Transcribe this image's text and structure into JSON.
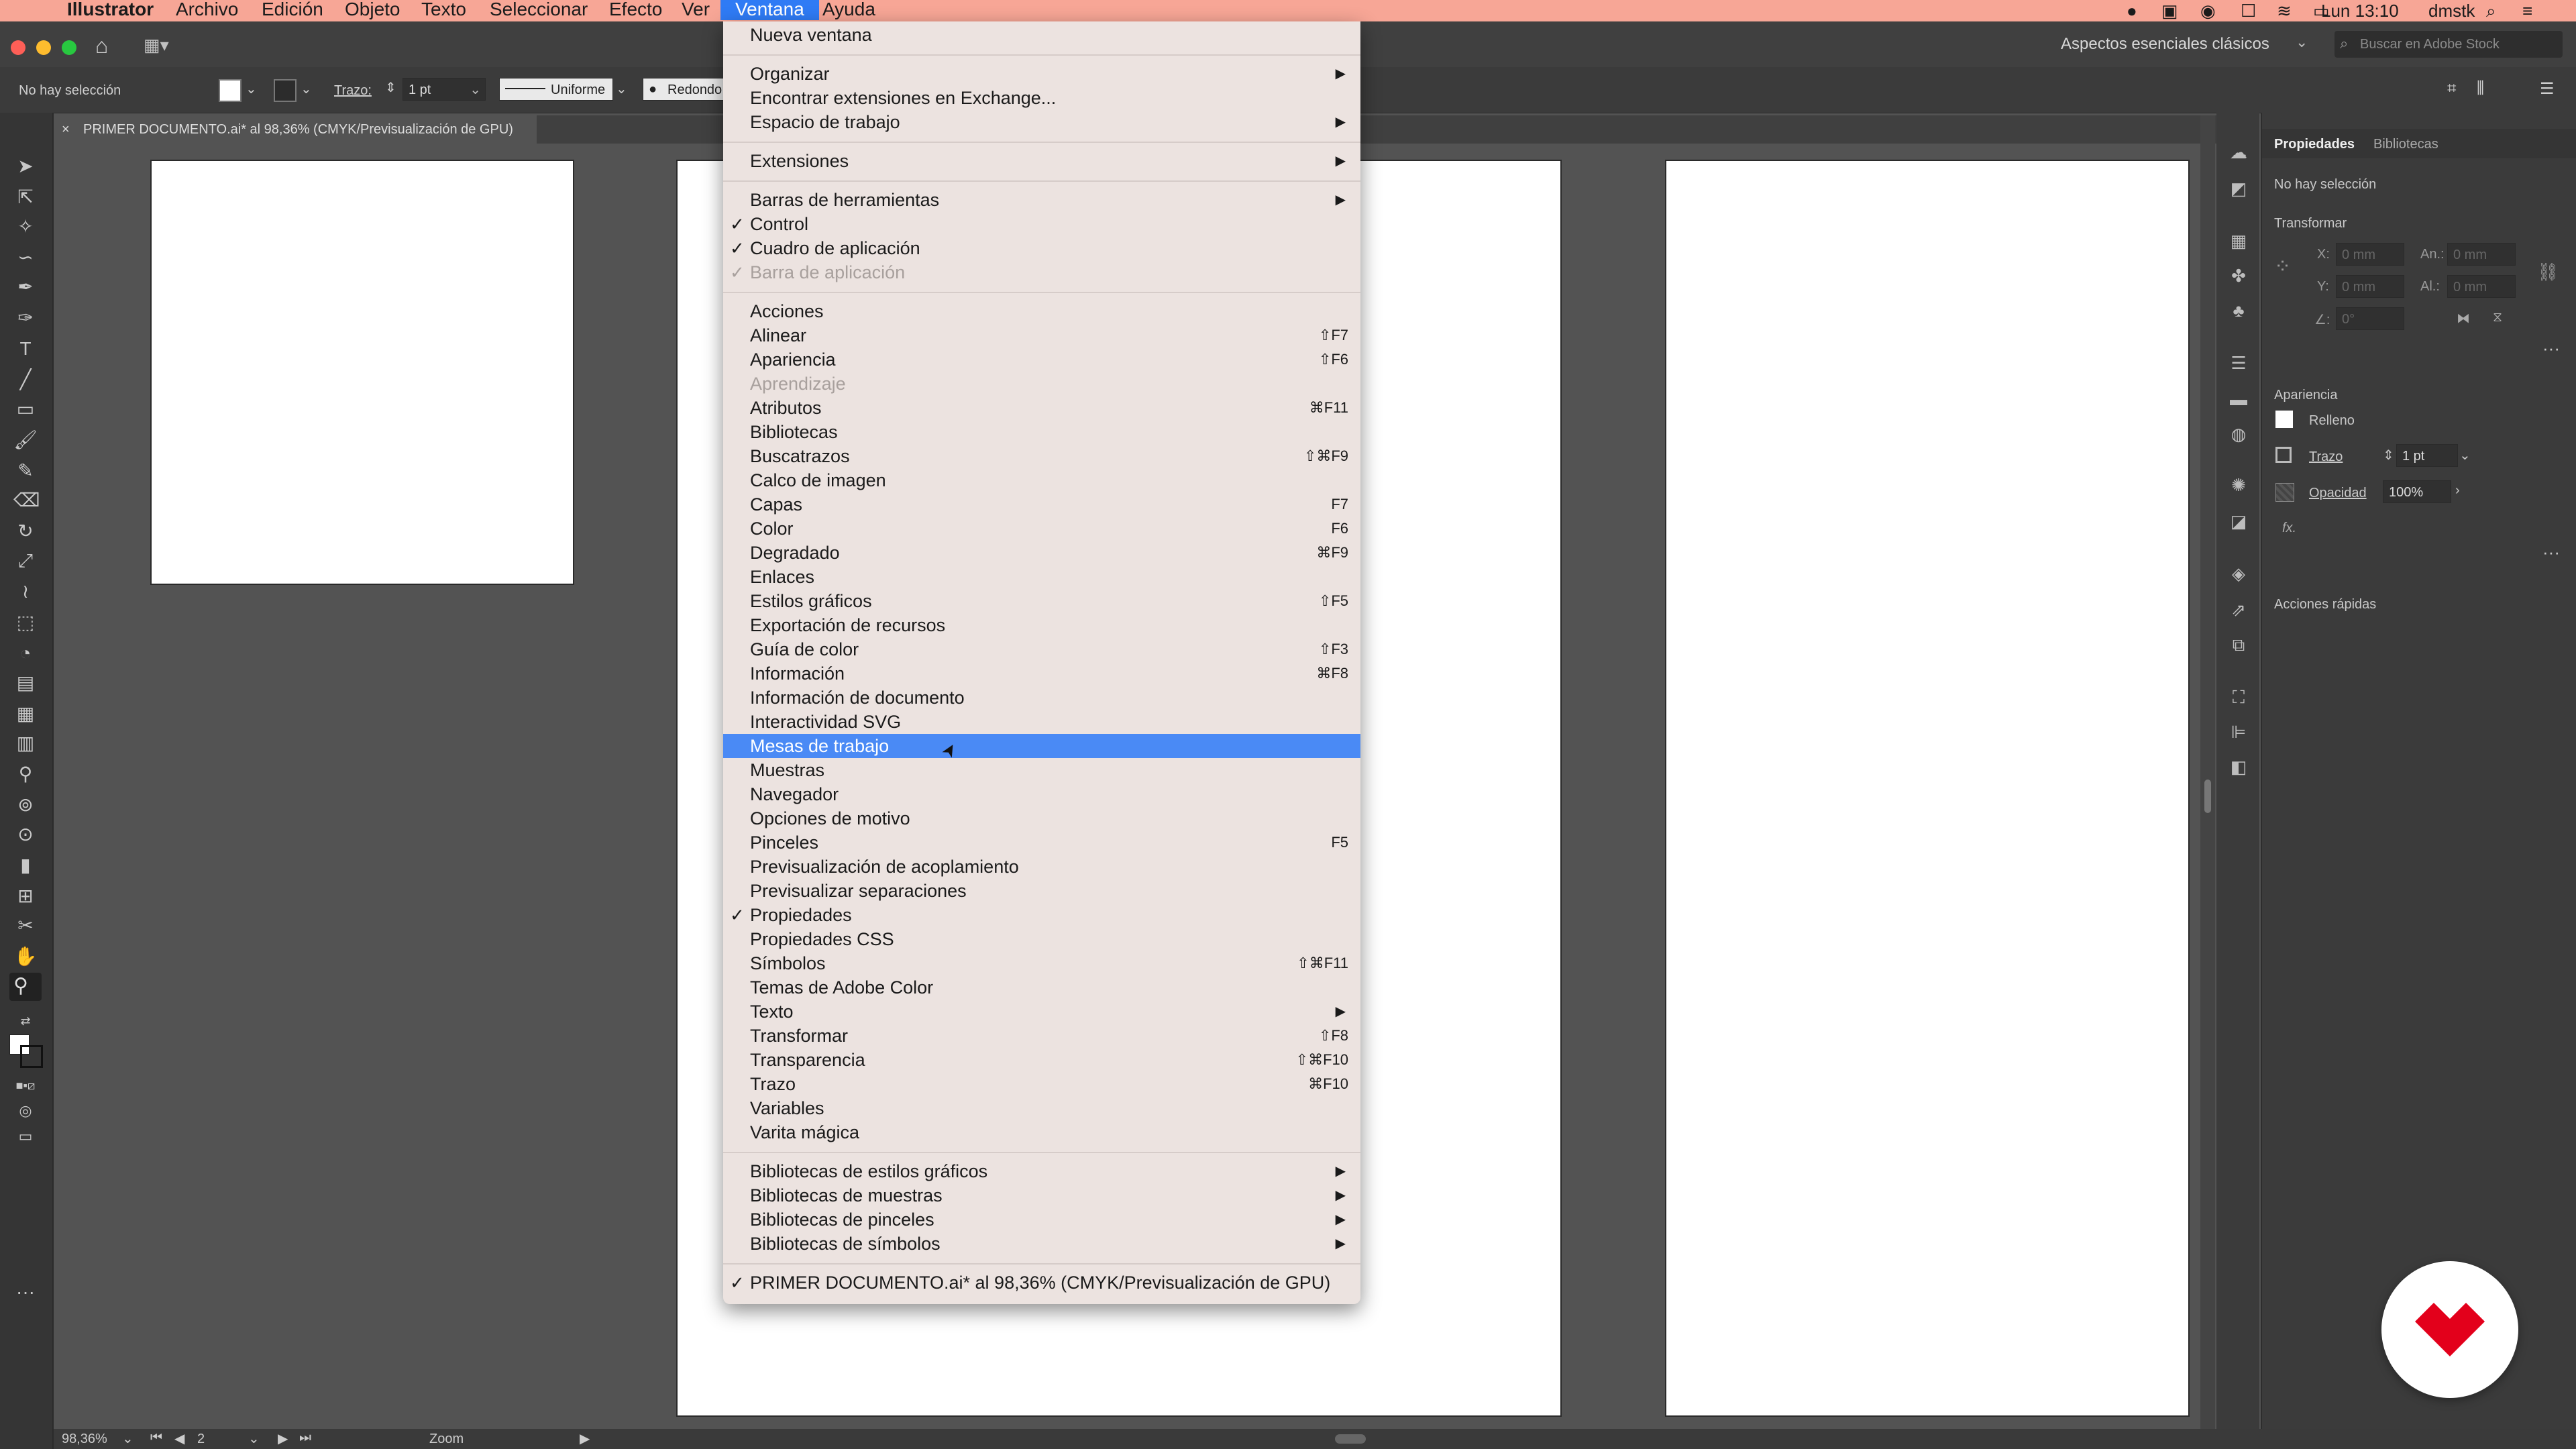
{
  "menubar": {
    "apple": "",
    "items": [
      "Illustrator",
      "Archivo",
      "Edición",
      "Objeto",
      "Texto",
      "Seleccionar",
      "Efecto",
      "Ver",
      "Ventana",
      "Ayuda"
    ],
    "clock": "Lun 13:10",
    "user": "dmstk"
  },
  "appbar": {
    "workspace": "Aspectos esenciales clásicos",
    "stock_placeholder": "Buscar en Adobe Stock"
  },
  "controlbar": {
    "selection": "No hay selección",
    "stroke_label": "Trazo:",
    "stroke_value": "1 pt",
    "profile": "Uniforme",
    "brush": "Redondo"
  },
  "document": {
    "tab_title": "PRIMER DOCUMENTO.ai* al 98,36% (CMYK/Previsualización de GPU)"
  },
  "status": {
    "zoom": "98,36%",
    "artboard": "2",
    "tool": "Zoom"
  },
  "properties": {
    "tab_properties": "Propiedades",
    "tab_libraries": "Bibliotecas",
    "no_selection": "No hay selección",
    "transform": "Transformar",
    "x_label": "X:",
    "y_label": "Y:",
    "w_label": "An.:",
    "h_label": "Al.:",
    "x_val": "0 mm",
    "y_val": "0 mm",
    "w_val": "0 mm",
    "h_val": "0 mm",
    "angle_label": "∠:",
    "angle_val": "0°",
    "appearance": "Apariencia",
    "fill": "Relleno",
    "stroke": "Trazo",
    "stroke_val": "1 pt",
    "opacity": "Opacidad",
    "opacity_val": "100%",
    "fx": "fx.",
    "quick_actions": "Acciones rápidas"
  },
  "menu": {
    "items": [
      {
        "label": "Nueva ventana",
        "shortcut": "",
        "submenu": false,
        "checked": false,
        "disabled": false
      },
      {
        "sep": true
      },
      {
        "label": "Organizar",
        "shortcut": "",
        "submenu": true,
        "checked": false,
        "disabled": false
      },
      {
        "label": "Encontrar extensiones en Exchange...",
        "shortcut": "",
        "submenu": false,
        "checked": false,
        "disabled": false
      },
      {
        "label": "Espacio de trabajo",
        "shortcut": "",
        "submenu": true,
        "checked": false,
        "disabled": false
      },
      {
        "sep": true
      },
      {
        "label": "Extensiones",
        "shortcut": "",
        "submenu": true,
        "checked": false,
        "disabled": false
      },
      {
        "sep": true
      },
      {
        "label": "Barras de herramientas",
        "shortcut": "",
        "submenu": true,
        "checked": false,
        "disabled": false
      },
      {
        "label": "Control",
        "shortcut": "",
        "submenu": false,
        "checked": true,
        "disabled": false
      },
      {
        "label": "Cuadro de aplicación",
        "shortcut": "",
        "submenu": false,
        "checked": true,
        "disabled": false
      },
      {
        "label": "Barra de aplicación",
        "shortcut": "",
        "submenu": false,
        "checked": true,
        "disabled": true
      },
      {
        "sep": true
      },
      {
        "label": "Acciones",
        "shortcut": "",
        "submenu": false,
        "checked": false,
        "disabled": false
      },
      {
        "label": "Alinear",
        "shortcut": "⇧F7",
        "submenu": false,
        "checked": false,
        "disabled": false
      },
      {
        "label": "Apariencia",
        "shortcut": "⇧F6",
        "submenu": false,
        "checked": false,
        "disabled": false
      },
      {
        "label": "Aprendizaje",
        "shortcut": "",
        "submenu": false,
        "checked": false,
        "disabled": true
      },
      {
        "label": "Atributos",
        "shortcut": "⌘F11",
        "submenu": false,
        "checked": false,
        "disabled": false
      },
      {
        "label": "Bibliotecas",
        "shortcut": "",
        "submenu": false,
        "checked": false,
        "disabled": false
      },
      {
        "label": "Buscatrazos",
        "shortcut": "⇧⌘F9",
        "submenu": false,
        "checked": false,
        "disabled": false
      },
      {
        "label": "Calco de imagen",
        "shortcut": "",
        "submenu": false,
        "checked": false,
        "disabled": false
      },
      {
        "label": "Capas",
        "shortcut": "F7",
        "submenu": false,
        "checked": false,
        "disabled": false
      },
      {
        "label": "Color",
        "shortcut": "F6",
        "submenu": false,
        "checked": false,
        "disabled": false
      },
      {
        "label": "Degradado",
        "shortcut": "⌘F9",
        "submenu": false,
        "checked": false,
        "disabled": false
      },
      {
        "label": "Enlaces",
        "shortcut": "",
        "submenu": false,
        "checked": false,
        "disabled": false
      },
      {
        "label": "Estilos gráficos",
        "shortcut": "⇧F5",
        "submenu": false,
        "checked": false,
        "disabled": false
      },
      {
        "label": "Exportación de recursos",
        "shortcut": "",
        "submenu": false,
        "checked": false,
        "disabled": false
      },
      {
        "label": "Guía de color",
        "shortcut": "⇧F3",
        "submenu": false,
        "checked": false,
        "disabled": false
      },
      {
        "label": "Información",
        "shortcut": "⌘F8",
        "submenu": false,
        "checked": false,
        "disabled": false
      },
      {
        "label": "Información de documento",
        "shortcut": "",
        "submenu": false,
        "checked": false,
        "disabled": false
      },
      {
        "label": "Interactividad SVG",
        "shortcut": "",
        "submenu": false,
        "checked": false,
        "disabled": false
      },
      {
        "label": "Mesas de trabajo",
        "shortcut": "",
        "submenu": false,
        "checked": false,
        "disabled": false,
        "highlight": true
      },
      {
        "label": "Muestras",
        "shortcut": "",
        "submenu": false,
        "checked": false,
        "disabled": false
      },
      {
        "label": "Navegador",
        "shortcut": "",
        "submenu": false,
        "checked": false,
        "disabled": false
      },
      {
        "label": "Opciones de motivo",
        "shortcut": "",
        "submenu": false,
        "checked": false,
        "disabled": false
      },
      {
        "label": "Pinceles",
        "shortcut": "F5",
        "submenu": false,
        "checked": false,
        "disabled": false
      },
      {
        "label": "Previsualización de acoplamiento",
        "shortcut": "",
        "submenu": false,
        "checked": false,
        "disabled": false
      },
      {
        "label": "Previsualizar separaciones",
        "shortcut": "",
        "submenu": false,
        "checked": false,
        "disabled": false
      },
      {
        "label": "Propiedades",
        "shortcut": "",
        "submenu": false,
        "checked": true,
        "disabled": false
      },
      {
        "label": "Propiedades CSS",
        "shortcut": "",
        "submenu": false,
        "checked": false,
        "disabled": false
      },
      {
        "label": "Símbolos",
        "shortcut": "⇧⌘F11",
        "submenu": false,
        "checked": false,
        "disabled": false
      },
      {
        "label": "Temas de Adobe Color",
        "shortcut": "",
        "submenu": false,
        "checked": false,
        "disabled": false
      },
      {
        "label": "Texto",
        "shortcut": "",
        "submenu": true,
        "checked": false,
        "disabled": false
      },
      {
        "label": "Transformar",
        "shortcut": "⇧F8",
        "submenu": false,
        "checked": false,
        "disabled": false
      },
      {
        "label": "Transparencia",
        "shortcut": "⇧⌘F10",
        "submenu": false,
        "checked": false,
        "disabled": false
      },
      {
        "label": "Trazo",
        "shortcut": "⌘F10",
        "submenu": false,
        "checked": false,
        "disabled": false
      },
      {
        "label": "Variables",
        "shortcut": "",
        "submenu": false,
        "checked": false,
        "disabled": false
      },
      {
        "label": "Varita mágica",
        "shortcut": "",
        "submenu": false,
        "checked": false,
        "disabled": false
      },
      {
        "sep": true
      },
      {
        "label": "Bibliotecas de estilos gráficos",
        "shortcut": "",
        "submenu": true,
        "checked": false,
        "disabled": false
      },
      {
        "label": "Bibliotecas de muestras",
        "shortcut": "",
        "submenu": true,
        "checked": false,
        "disabled": false
      },
      {
        "label": "Bibliotecas de pinceles",
        "shortcut": "",
        "submenu": true,
        "checked": false,
        "disabled": false
      },
      {
        "label": "Bibliotecas de símbolos",
        "shortcut": "",
        "submenu": true,
        "checked": false,
        "disabled": false
      },
      {
        "sep": true
      },
      {
        "label": "PRIMER DOCUMENTO.ai* al 98,36% (CMYK/Previsualización de GPU)",
        "shortcut": "",
        "submenu": false,
        "checked": true,
        "disabled": false
      }
    ]
  },
  "colors": {
    "menubar_bg": "#f7a696",
    "highlight": "#4a8af5",
    "brand_logo": "#e3001b"
  }
}
